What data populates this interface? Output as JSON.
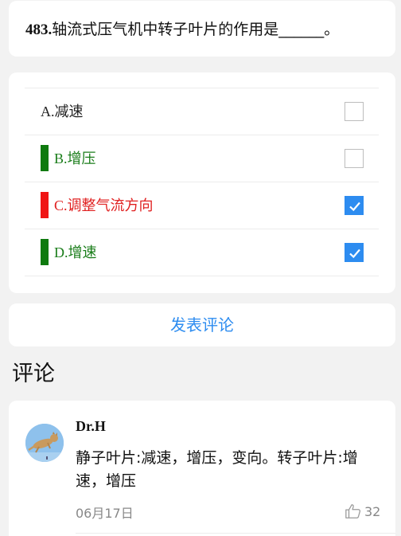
{
  "question": {
    "number": "483.",
    "text": "轴流式压气机中转子叶片的作用是______。"
  },
  "options": [
    {
      "letter": "A.",
      "text": "减速",
      "checked": false,
      "text_color": "#222222",
      "bar_color": null
    },
    {
      "letter": "B.",
      "text": "增压",
      "checked": false,
      "text_color": "#1a7d1a",
      "bar_color": "#0f7a0f"
    },
    {
      "letter": "C.",
      "text": "调整气流方向",
      "checked": true,
      "text_color": "#e02020",
      "bar_color": "#f01515"
    },
    {
      "letter": "D.",
      "text": "增速",
      "checked": true,
      "text_color": "#1a7d1a",
      "bar_color": "#0f7a0f"
    }
  ],
  "actions": {
    "comment_button_label": "发表评论"
  },
  "comments_section": {
    "heading": "评论",
    "items": [
      {
        "user": "Dr.H",
        "text": "静子叶片:减速，增压，变向。转子叶片:增速，增压",
        "date": "06月17日",
        "likes": "32",
        "avatar_icon": "cat-photo-avatar"
      }
    ]
  },
  "colors": {
    "accent": "#2d8cf0",
    "correct": "#0f7a0f",
    "wrong": "#f01515"
  }
}
